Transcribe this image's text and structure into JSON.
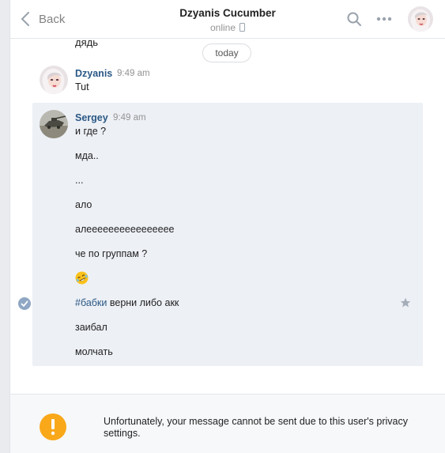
{
  "header": {
    "back_label": "Back",
    "title": "Dzyanis Cucumber",
    "status": "online"
  },
  "chat": {
    "previous_text": "дядь",
    "date_separator": "today",
    "groups": [
      {
        "author": "Dzyanis",
        "time": "9:49 am",
        "messages": [
          "Tut"
        ]
      },
      {
        "author": "Sergey",
        "time": "9:49 am",
        "messages": [
          "и где ?",
          "мда..",
          "...",
          "ало",
          "алееееееееееееееее",
          "че по группам ?",
          "",
          "",
          "заибал",
          "молчать"
        ],
        "hashtag_message": {
          "hashtag": "#бабки",
          "rest": " верни либо акк"
        }
      }
    ]
  },
  "footer": {
    "notice": "Unfortunately, your message cannot be sent due to this user's privacy settings."
  },
  "colors": {
    "link": "#2a5885",
    "selected_bg": "#edf0f5",
    "warning": "#f9a81a"
  },
  "icons": {
    "back": "chevron-left-icon",
    "search": "search-icon",
    "more": "more-horizontal-icon",
    "phone": "phone-icon",
    "check": "check-circle-icon",
    "star": "star-icon",
    "emoji": "rofl-emoji-icon",
    "warning": "exclamation-circle-icon"
  }
}
